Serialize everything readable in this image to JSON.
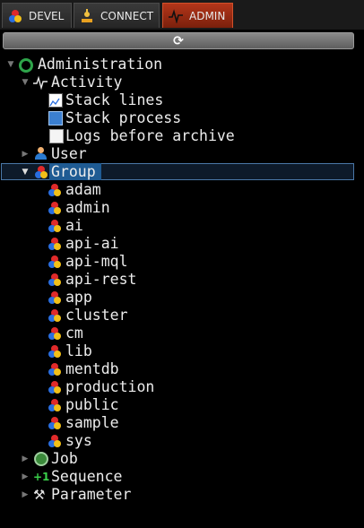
{
  "tabs": [
    {
      "label": "DEVEL",
      "icon": "group-icon",
      "active": false
    },
    {
      "label": "CONNECT",
      "icon": "connect-icon",
      "active": false
    },
    {
      "label": "ADMIN",
      "icon": "pulse-icon",
      "active": true
    }
  ],
  "refresh": {
    "icon": "refresh-icon",
    "glyph": "⟳"
  },
  "tree": {
    "root": {
      "label": "Administration",
      "icon": "administration-icon",
      "expanded": true
    },
    "activity": {
      "label": "Activity",
      "icon": "pulse-icon",
      "expanded": true,
      "children": [
        {
          "label": "Stack lines",
          "icon": "stack-lines-icon"
        },
        {
          "label": "Stack process",
          "icon": "stack-process-icon"
        },
        {
          "label": "Logs before archive",
          "icon": "document-icon"
        }
      ]
    },
    "user": {
      "label": "User",
      "icon": "user-icon",
      "expanded": false
    },
    "group": {
      "label": "Group",
      "icon": "group-icon",
      "expanded": true,
      "selected": true,
      "children": [
        "adam",
        "admin",
        "ai",
        "api-ai",
        "api-mql",
        "api-rest",
        "app",
        "cluster",
        "cm",
        "lib",
        "mentdb",
        "production",
        "public",
        "sample",
        "sys"
      ]
    },
    "job": {
      "label": "Job",
      "icon": "clock-icon",
      "expanded": false
    },
    "sequence": {
      "label": "Sequence",
      "icon": "plus-one-icon",
      "glyph": "+1",
      "expanded": false
    },
    "parameter": {
      "label": "Parameter",
      "icon": "tools-icon",
      "glyph": "⚒",
      "expanded": false
    }
  },
  "colors": {
    "selection": "#1f5b93",
    "active_tab": "#b3361a",
    "admin_green": "#2ea44a"
  }
}
